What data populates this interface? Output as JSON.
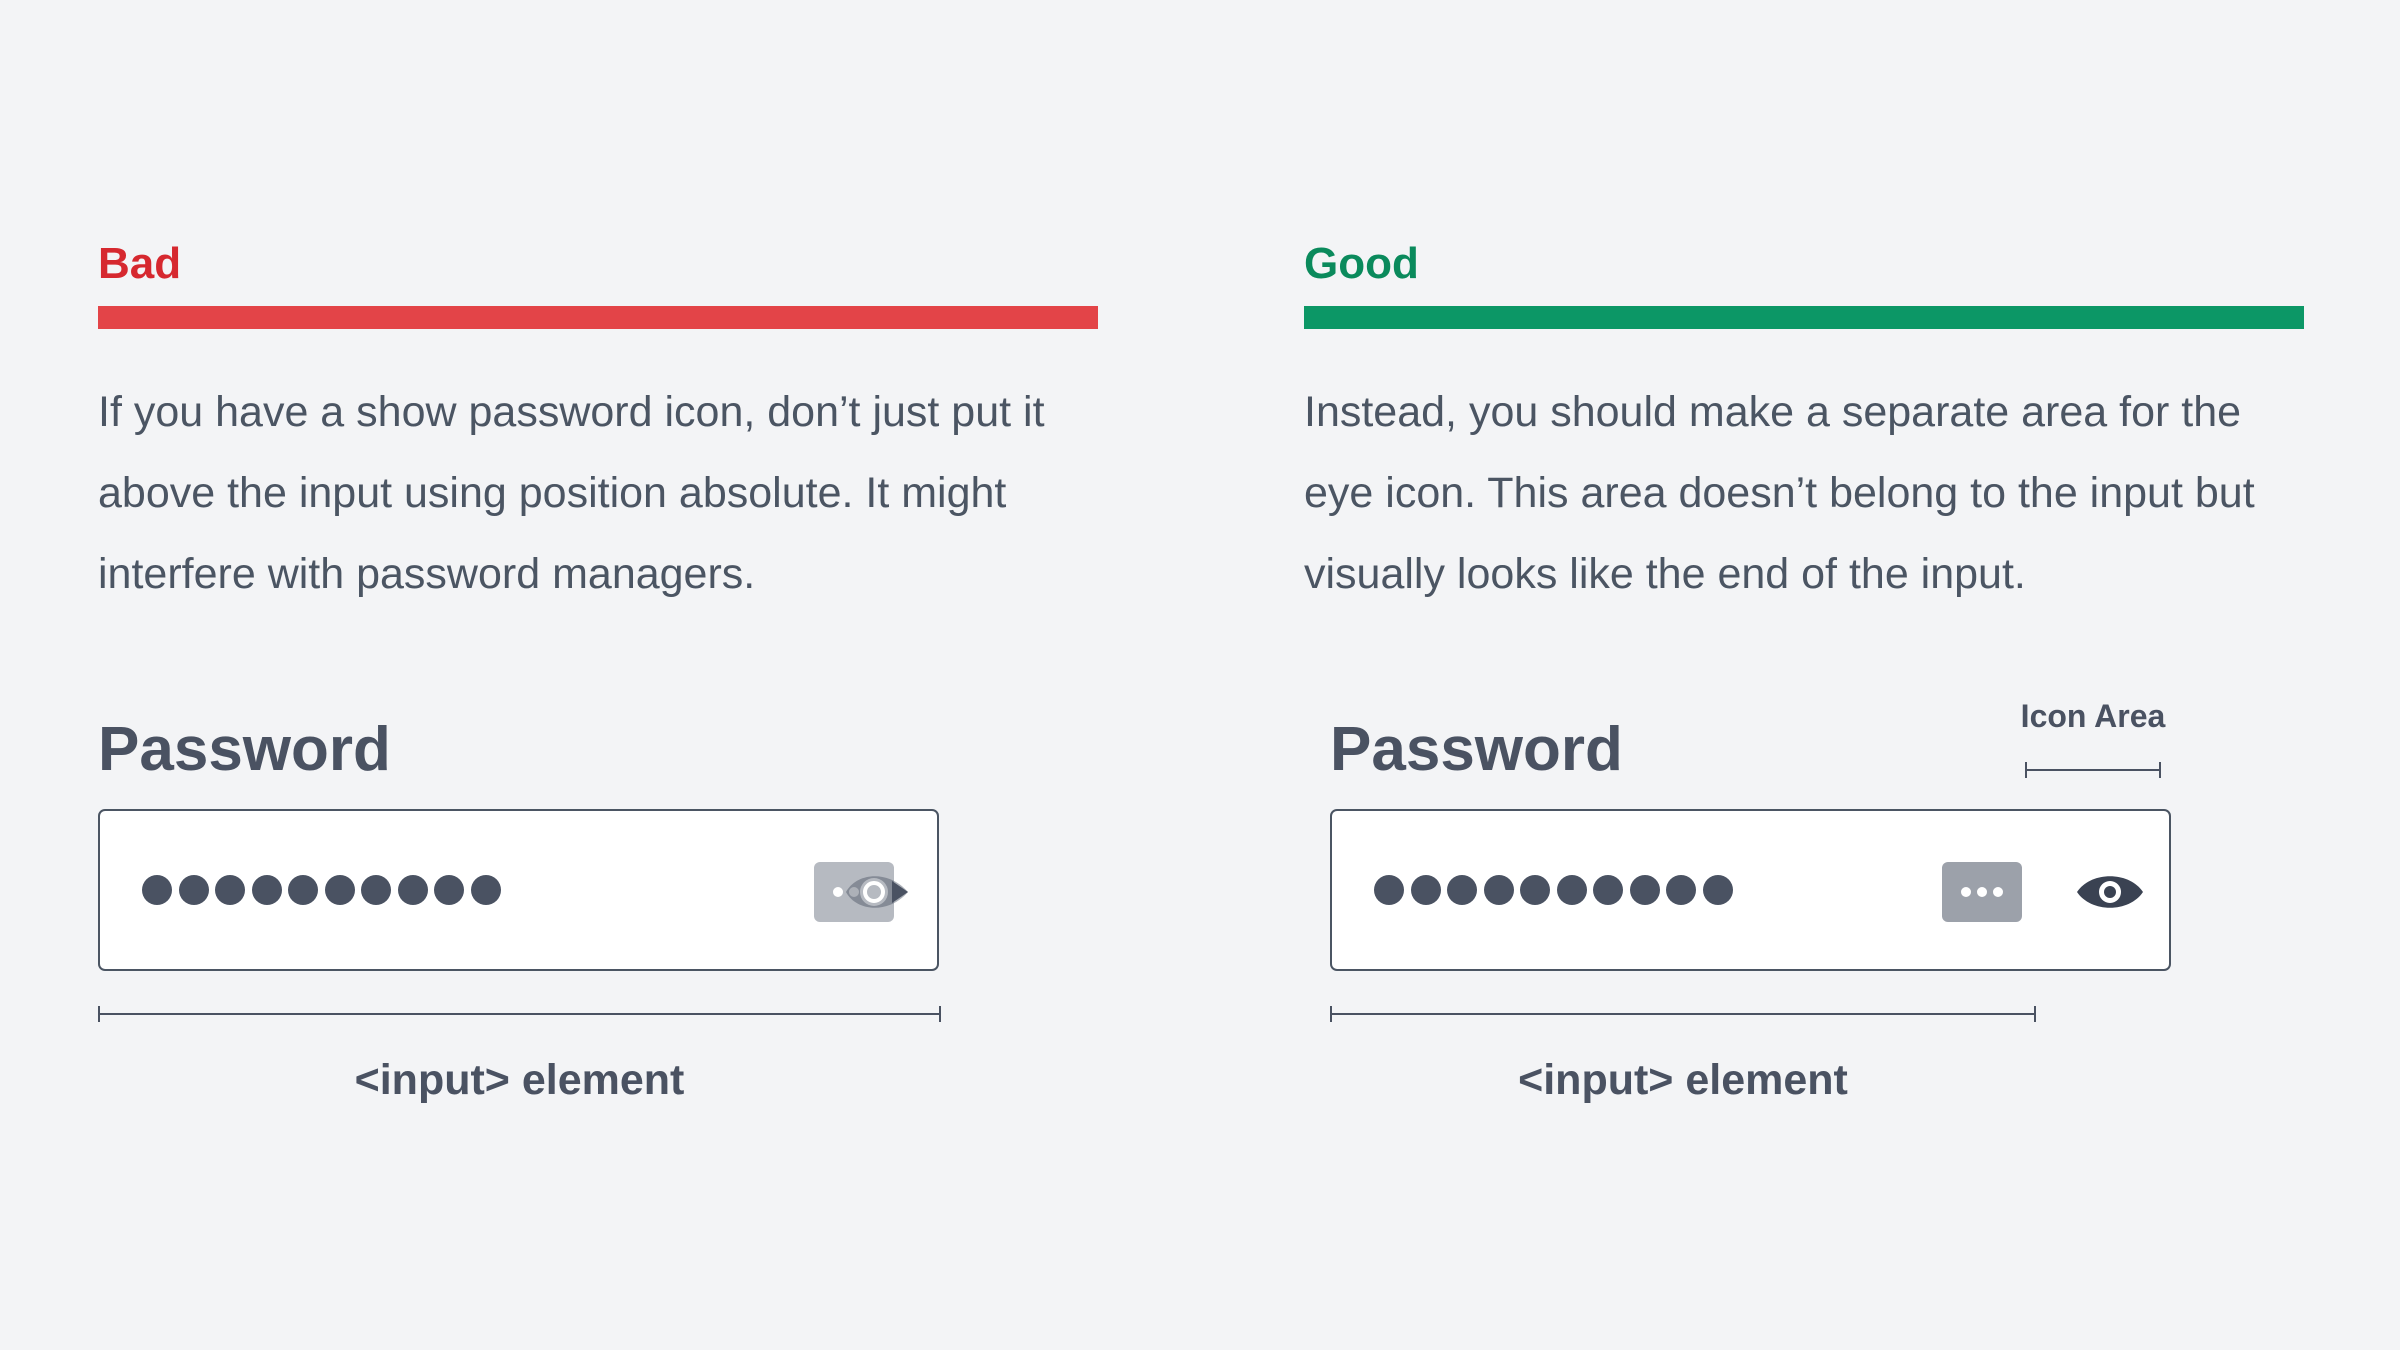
{
  "bad": {
    "heading": "Bad",
    "color": "#e34448",
    "heading_color": "#d6282f",
    "description_lines": [
      "If you have a show password icon, don’t just put it",
      "above the input using position absolute. It might",
      "interfere with password managers."
    ],
    "field_label": "Password",
    "password_dot_count": 10,
    "dimension_label": "<input> element"
  },
  "good": {
    "heading": "Good",
    "color": "#0c9766",
    "heading_color": "#0a8a5c",
    "description_lines": [
      "Instead, you should make a separate area for the",
      "eye icon. This area doesn’t belong to the input but",
      "visually looks like the end of the input."
    ],
    "field_label": "Password",
    "password_dot_count": 10,
    "icon_area_label": "Icon Area",
    "dimension_label": "<input> element"
  },
  "icons": {
    "password_manager": "password-manager-icon",
    "show_password": "eye-icon"
  }
}
